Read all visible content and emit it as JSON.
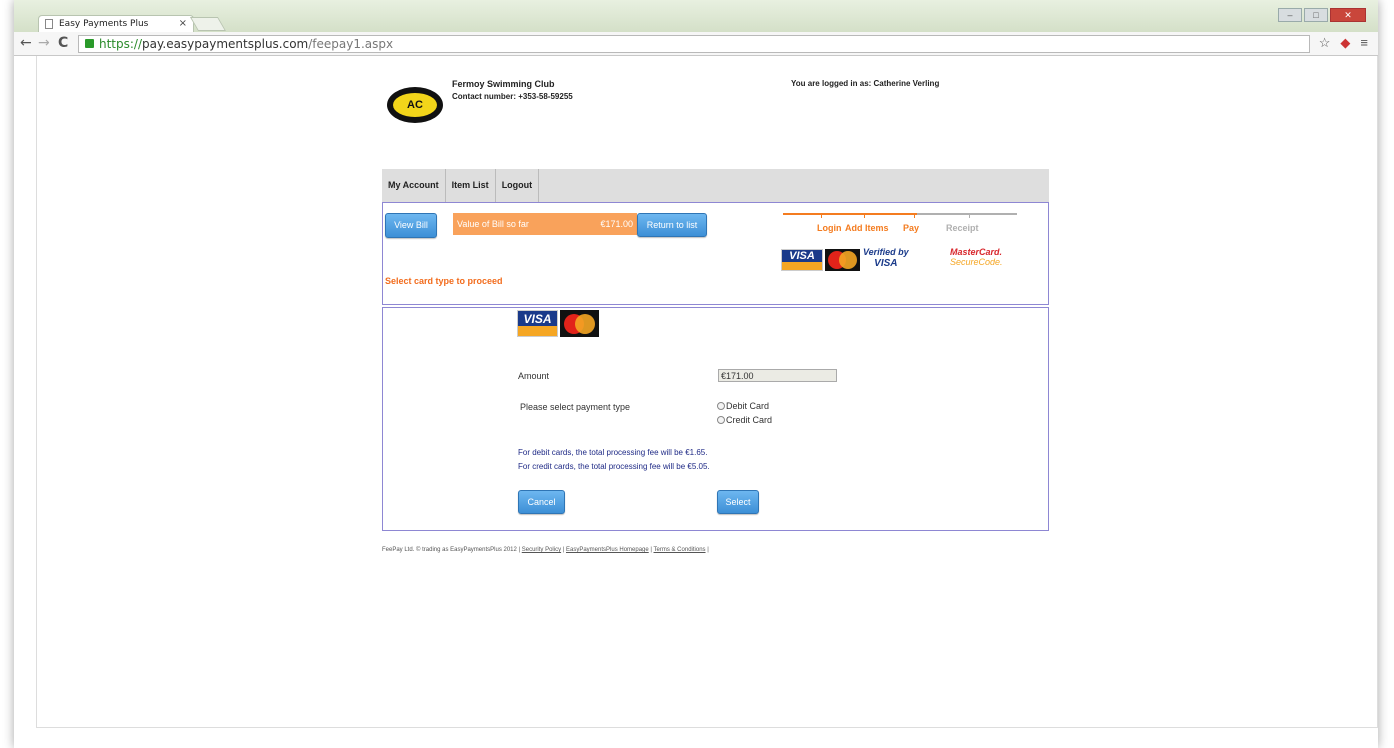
{
  "browser": {
    "tab_title": "Easy Payments Plus",
    "tab_close": "×",
    "url_scheme": "https://",
    "url_host": "pay.easypaymentsplus.com",
    "url_path": "/feepay1.aspx",
    "back": "←",
    "forward": "→",
    "reload": "C",
    "star": "☆",
    "menu": "≡"
  },
  "header": {
    "club_name": "Fermoy Swimming Club",
    "contact": "Contact number: +353-58-59255",
    "logged_in": "You are logged in as: Catherine Verling",
    "logo_text": "AC"
  },
  "menu": {
    "items": [
      {
        "label": "My Account"
      },
      {
        "label": "Item List"
      },
      {
        "label": "Logout"
      }
    ]
  },
  "bill": {
    "view_bill": "View Bill",
    "value_label": "Value of Bill so far",
    "value_amount": "€171.00",
    "return_to_list": "Return to list",
    "select_card_msg": "Select card type to proceed"
  },
  "progress": {
    "steps": [
      {
        "label": "Login",
        "state": "done"
      },
      {
        "label": "Add Items",
        "state": "done"
      },
      {
        "label": "Pay",
        "state": "current"
      },
      {
        "label": "Receipt",
        "state": "pending"
      }
    ],
    "active_color": "#f47c20",
    "pending_color": "#b0b0b0"
  },
  "badges": {
    "visa": "VISA",
    "mastercard": "MasterCard",
    "verified_line1": "Verified by",
    "verified_line2": "VISA",
    "securecode_line1": "MasterCard.",
    "securecode_line2": "SecureCode."
  },
  "payment_form": {
    "amount_label": "Amount",
    "amount_value": "€171.00",
    "payment_type_label": "Please select payment type",
    "options": [
      "Debit Card",
      "Credit Card"
    ],
    "debit_fee_note": "For debit cards, the total processing fee will be €1.65.",
    "credit_fee_note": "For credit cards, the total processing fee will be €5.05.",
    "cancel": "Cancel",
    "select": "Select"
  },
  "footer": {
    "copyright": "FeePay Ltd. © trading as EasyPaymentsPlus 2012 |",
    "security_policy": "Security Policy",
    "homepage": "EasyPaymentsPlus Homepage",
    "terms": "Terms & Conditions",
    "separator": "|"
  }
}
